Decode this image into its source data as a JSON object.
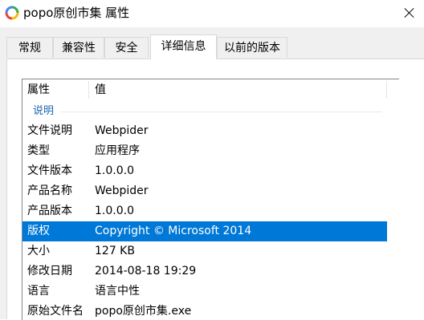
{
  "window": {
    "title": "popo原创市集 属性",
    "icon": "circular-app-icon",
    "close_icon": "close-icon"
  },
  "tabs": [
    {
      "label": "常规"
    },
    {
      "label": "兼容性"
    },
    {
      "label": "安全"
    },
    {
      "label": "详细信息",
      "active": true
    },
    {
      "label": "以前的版本"
    }
  ],
  "details": {
    "columns": {
      "property": "属性",
      "value": "值"
    },
    "group_label": "说明",
    "rows": [
      {
        "key": "文件说明",
        "value": "Webpider"
      },
      {
        "key": "类型",
        "value": "应用程序"
      },
      {
        "key": "文件版本",
        "value": "1.0.0.0"
      },
      {
        "key": "产品名称",
        "value": "Webpider"
      },
      {
        "key": "产品版本",
        "value": "1.0.0.0"
      },
      {
        "key": "版权",
        "value": "Copyright © Microsoft 2014",
        "selected": true
      },
      {
        "key": "大小",
        "value": "127 KB"
      },
      {
        "key": "修改日期",
        "value": "2014-08-18 19:29"
      },
      {
        "key": "语言",
        "value": "语言中性"
      },
      {
        "key": "原始文件名",
        "value": "popo原创市集.exe"
      }
    ]
  },
  "colors": {
    "selection": "#0078d7",
    "group_label": "#1e64b4",
    "dialog_bg": "#f0f0f0"
  }
}
